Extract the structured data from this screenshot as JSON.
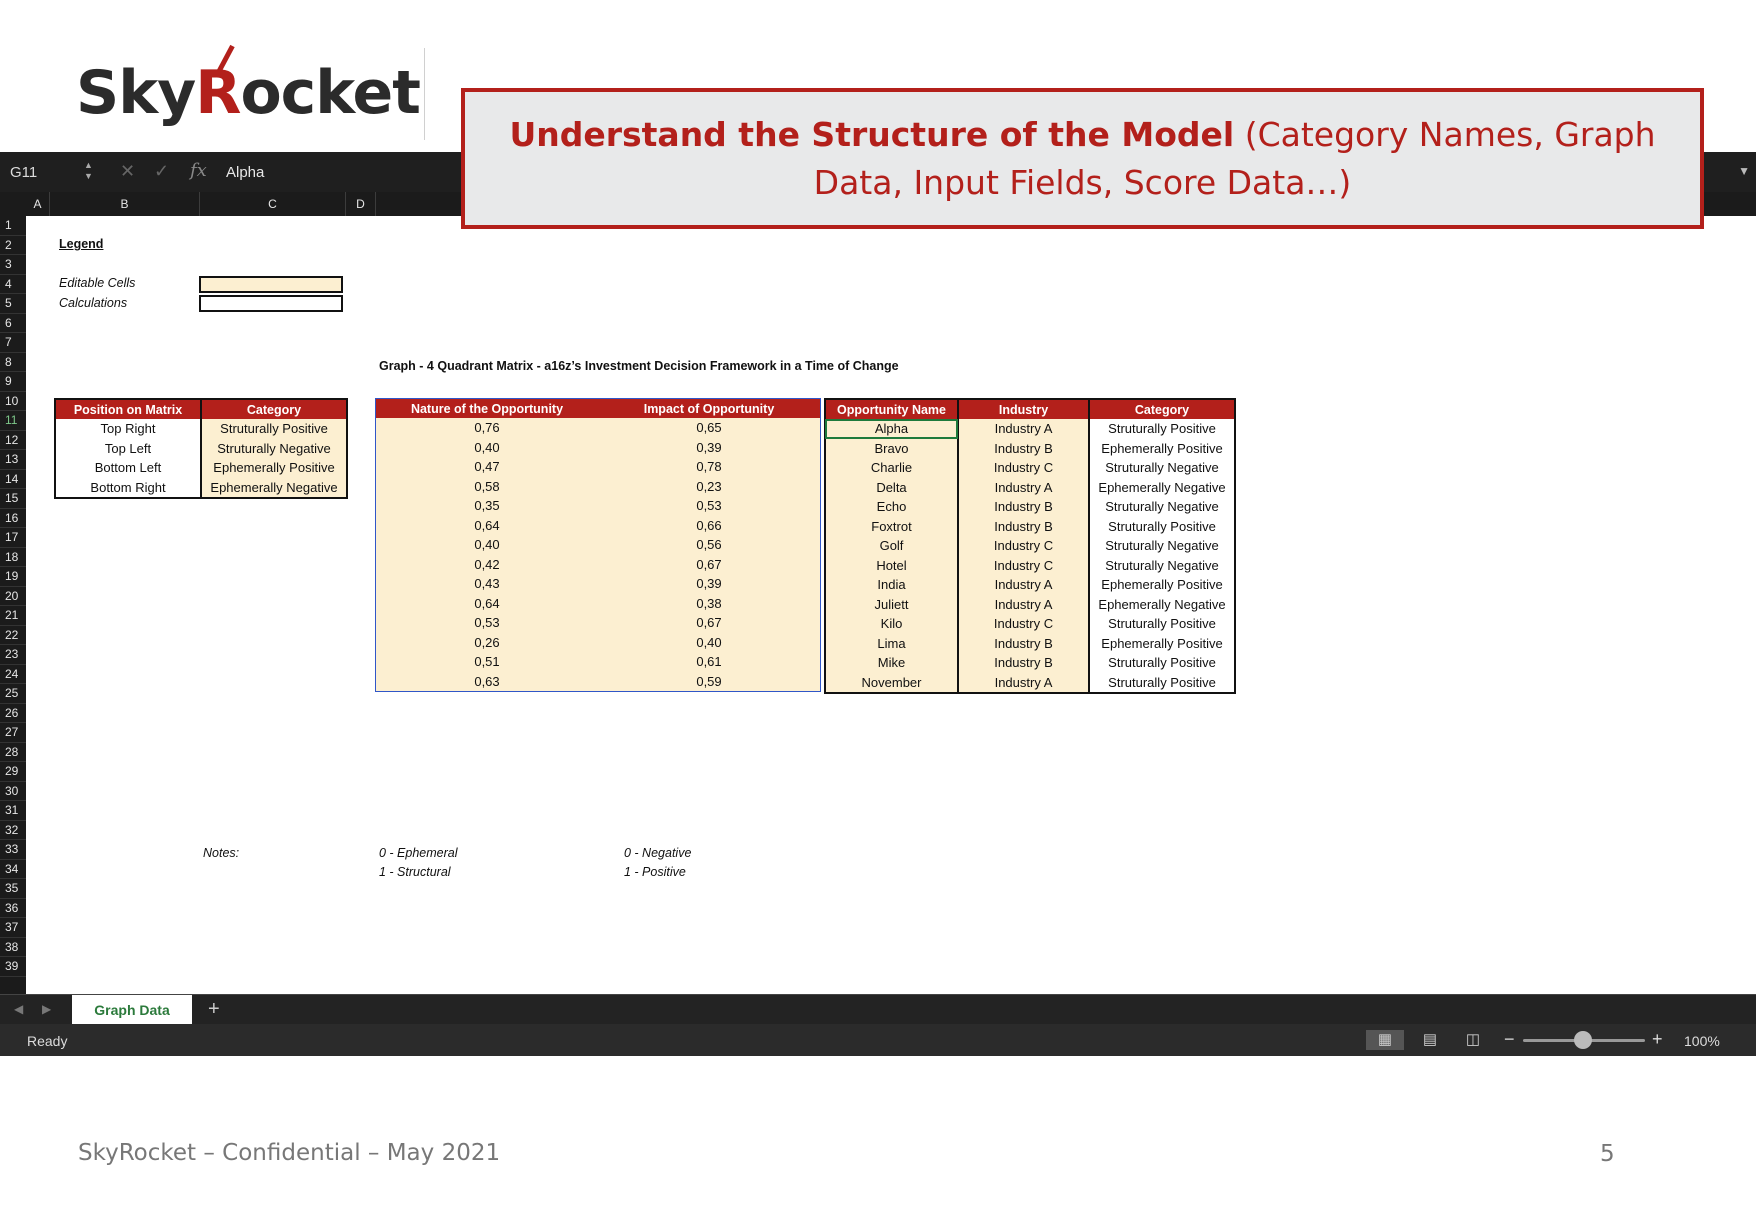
{
  "slide": {
    "logo_text": "SkyRocket",
    "callout_bold": "Understand the Structure of the Model",
    "callout_rest": " (Category Names, Graph Data, Input Fields, Score Data…)",
    "footer": "SkyRocket – Confidential – May 2021",
    "page_number": "5"
  },
  "formula_bar": {
    "name_box": "G11",
    "fx": "fx",
    "value": "Alpha"
  },
  "columns": [
    "A",
    "B",
    "C",
    "D"
  ],
  "rows": [
    "1",
    "2",
    "3",
    "4",
    "5",
    "6",
    "7",
    "8",
    "9",
    "10",
    "11",
    "12",
    "13",
    "14",
    "15",
    "16",
    "17",
    "18",
    "19",
    "20",
    "21",
    "22",
    "23",
    "24",
    "25",
    "26",
    "27",
    "28",
    "29",
    "30",
    "31",
    "32",
    "33",
    "34",
    "35",
    "36",
    "37",
    "38",
    "39"
  ],
  "legend": {
    "title": "Legend",
    "editable": "Editable Cells",
    "calculations": "Calculations"
  },
  "graph_title": "Graph - 4 Quadrant Matrix  - a16z’s Investment Decision Framework in a Time of Change",
  "matrix_table": {
    "headers": [
      "Position on Matrix",
      "Category"
    ],
    "rows": [
      [
        "Top Right",
        "Struturally Positive"
      ],
      [
        "Top Left",
        "Struturally Negative"
      ],
      [
        "Bottom Left",
        "Ephemerally Positive"
      ],
      [
        "Bottom Right",
        "Ephemerally Negative"
      ]
    ]
  },
  "data_table": {
    "headers": [
      "Nature of the Opportunity",
      "Impact of Opportunity"
    ],
    "rows": [
      [
        "0,76",
        "0,65"
      ],
      [
        "0,40",
        "0,39"
      ],
      [
        "0,47",
        "0,78"
      ],
      [
        "0,58",
        "0,23"
      ],
      [
        "0,35",
        "0,53"
      ],
      [
        "0,64",
        "0,66"
      ],
      [
        "0,40",
        "0,56"
      ],
      [
        "0,42",
        "0,67"
      ],
      [
        "0,43",
        "0,39"
      ],
      [
        "0,64",
        "0,38"
      ],
      [
        "0,53",
        "0,67"
      ],
      [
        "0,26",
        "0,40"
      ],
      [
        "0,51",
        "0,61"
      ],
      [
        "0,63",
        "0,59"
      ]
    ]
  },
  "opp_table": {
    "headers": [
      "Opportunity Name",
      "Industry",
      "Category"
    ],
    "rows": [
      [
        "Alpha",
        "Industry A",
        "Struturally Positive"
      ],
      [
        "Bravo",
        "Industry B",
        "Ephemerally Positive"
      ],
      [
        "Charlie",
        "Industry C",
        "Struturally Negative"
      ],
      [
        "Delta",
        "Industry A",
        "Ephemerally Negative"
      ],
      [
        "Echo",
        "Industry B",
        "Struturally Negative"
      ],
      [
        "Foxtrot",
        "Industry B",
        "Struturally Positive"
      ],
      [
        "Golf",
        "Industry C",
        "Struturally Negative"
      ],
      [
        "Hotel",
        "Industry C",
        "Struturally Negative"
      ],
      [
        "India",
        "Industry A",
        "Ephemerally Positive"
      ],
      [
        "Juliett",
        "Industry A",
        "Ephemerally Negative"
      ],
      [
        "Kilo",
        "Industry C",
        "Struturally Positive"
      ],
      [
        "Lima",
        "Industry B",
        "Ephemerally Positive"
      ],
      [
        "Mike",
        "Industry B",
        "Struturally Positive"
      ],
      [
        "November",
        "Industry A",
        "Struturally Positive"
      ]
    ]
  },
  "notes": {
    "label": "Notes:",
    "nature_0": "0 - Ephemeral",
    "nature_1": "1 - Structural",
    "impact_0": "0 - Negative",
    "impact_1": "1 - Positive"
  },
  "sheet_tab": "Graph Data",
  "add_tab": "+",
  "status": "Ready",
  "zoom": "100%",
  "colors": {
    "brand_red": "#b3201b",
    "editable_fill": "#fcefd1",
    "active_tab_green": "#2b7a3b"
  }
}
